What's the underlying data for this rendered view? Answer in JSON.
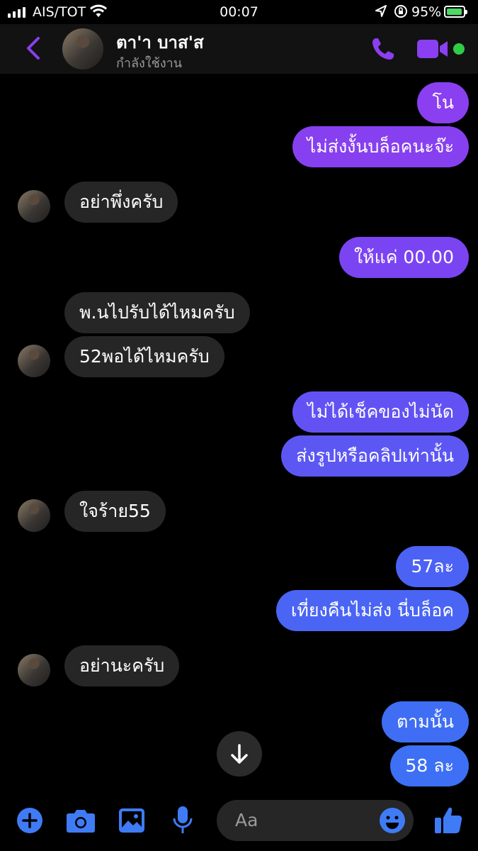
{
  "status": {
    "carrier": "AIS/TOT",
    "time": "00:07",
    "battery": "95%"
  },
  "header": {
    "name": "ตา'า บาส'ส",
    "status": "กำลังใช้งาน"
  },
  "messages": [
    {
      "side": "out",
      "text": "โน"
    },
    {
      "side": "out",
      "text": "ไม่ส่งงั้นบล็อคนะจ๊ะ"
    },
    {
      "side": "in",
      "text": "อย่าพึ่งครับ"
    },
    {
      "side": "out",
      "text": "ให้แค่ 00.00"
    },
    {
      "side": "in",
      "text": "พ.นไปรับได้ไหมครับ"
    },
    {
      "side": "in",
      "text": "52พอได้ไหมครับ"
    },
    {
      "side": "out",
      "text": "ไม่ได้เช็คของไม่นัด"
    },
    {
      "side": "out",
      "text": "ส่งรูปหรือคลิปเท่านั้น"
    },
    {
      "side": "in",
      "text": "ใจร้าย55"
    },
    {
      "side": "out",
      "text": "57ละ"
    },
    {
      "side": "out",
      "text": "เที่ยงคืนไม่ส่ง นี่บล็อค"
    },
    {
      "side": "in",
      "text": "อย่านะครับ"
    },
    {
      "side": "out",
      "text": "ตามนั้น"
    },
    {
      "side": "out",
      "text": "58 ละ"
    }
  ],
  "composer": {
    "placeholder": "Aa"
  },
  "colors": {
    "accent": "#7b3ff2",
    "bubble_purple": "#8a3ff0",
    "bubble_blue": "#3f6ef4",
    "incoming": "#262626",
    "online": "#31cc46"
  },
  "icons": [
    "back-chevron-icon",
    "phone-icon",
    "video-camera-icon",
    "plus-icon",
    "camera-icon",
    "image-icon",
    "microphone-icon",
    "emoji-icon",
    "thumbs-up-icon",
    "arrow-down-icon"
  ]
}
